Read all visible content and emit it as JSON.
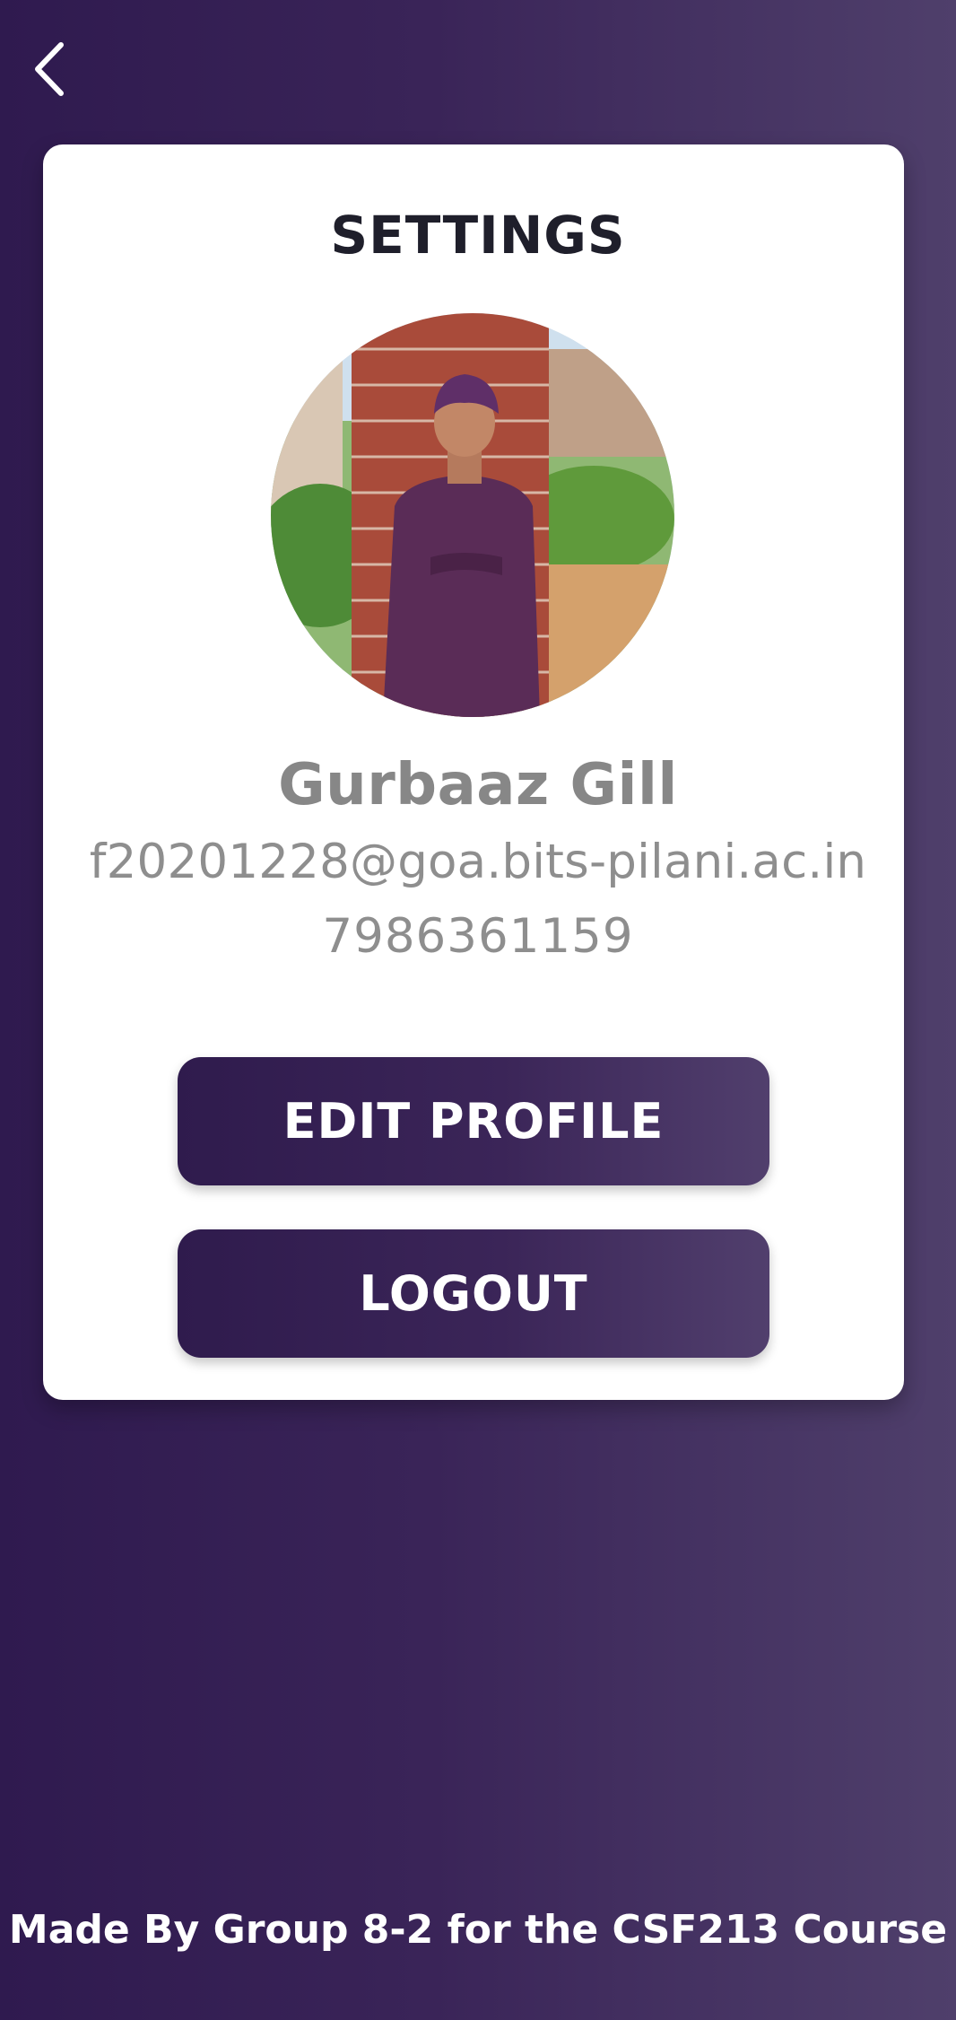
{
  "header": {
    "back_icon": "chevron-left-icon"
  },
  "settings": {
    "title": "SETTINGS",
    "avatar_icon": "profile-photo",
    "user": {
      "name": "Gurbaaz Gill",
      "email": "f20201228@goa.bits-pilani.ac.in",
      "phone": "7986361159"
    },
    "buttons": {
      "edit_profile": "EDIT PROFILE",
      "logout": "LOGOUT"
    }
  },
  "footer": {
    "text": "Made By Group 8-2 for the CSF213 Course"
  },
  "colors": {
    "background_start": "#2f1a4f",
    "background_end": "#4f3f6b",
    "card": "#ffffff",
    "title": "#1f1f2b",
    "muted_text": "#8e8e8e",
    "button_text": "#ffffff"
  }
}
